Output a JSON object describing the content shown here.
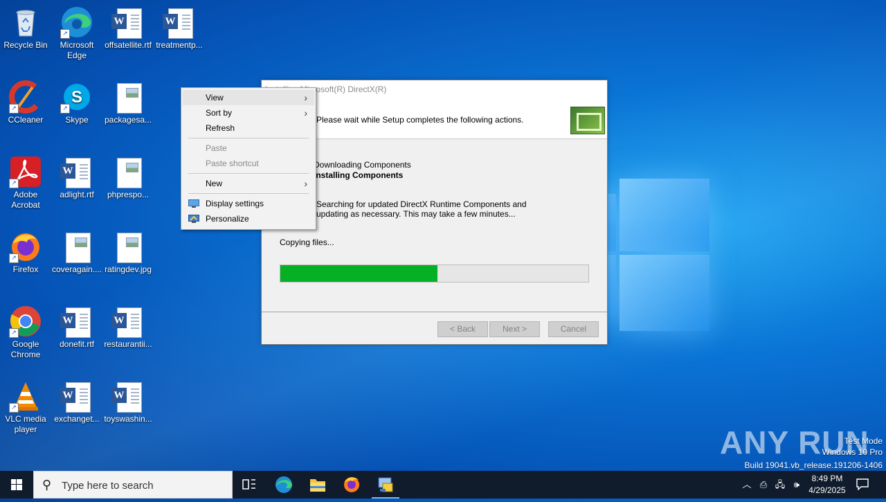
{
  "desktop": {
    "icons": [
      {
        "label": "Recycle Bin",
        "icon": "recycle-bin-icon"
      },
      {
        "label": "Microsoft Edge",
        "icon": "edge-icon"
      },
      {
        "label": "offsatellite.rtf",
        "icon": "word-doc-icon"
      },
      {
        "label": "treatmentp...",
        "icon": "word-doc-icon"
      },
      {
        "label": "CCleaner",
        "icon": "ccleaner-icon"
      },
      {
        "label": "Skype",
        "icon": "skype-icon"
      },
      {
        "label": "packagesa...",
        "icon": "image-file-icon"
      },
      {
        "label": "Adobe Acrobat",
        "icon": "acrobat-icon"
      },
      {
        "label": "adlight.rtf",
        "icon": "word-doc-icon"
      },
      {
        "label": "phprespo...",
        "icon": "image-file-icon"
      },
      {
        "label": "Firefox",
        "icon": "firefox-icon"
      },
      {
        "label": "coveragain....",
        "icon": "image-file-icon"
      },
      {
        "label": "ratingdev.jpg",
        "icon": "image-file-icon"
      },
      {
        "label": "Google Chrome",
        "icon": "chrome-icon"
      },
      {
        "label": "donefit.rtf",
        "icon": "word-doc-icon"
      },
      {
        "label": "restaurantii...",
        "icon": "word-doc-icon"
      },
      {
        "label": "VLC media player",
        "icon": "vlc-icon"
      },
      {
        "label": "exchanget...",
        "icon": "word-doc-icon"
      },
      {
        "label": "toyswashin...",
        "icon": "word-doc-icon"
      }
    ]
  },
  "context_menu": {
    "view": "View",
    "sort_by": "Sort by",
    "refresh": "Refresh",
    "paste": "Paste",
    "paste_shortcut": "Paste shortcut",
    "new": "New",
    "display_settings": "Display settings",
    "personalize": "Personalize"
  },
  "installer": {
    "title": "Installing Microsoft(R) DirectX(R)",
    "description": "Please wait while Setup completes the following actions.",
    "step_done": "Downloading Components",
    "step_current": "Installing Components",
    "detail": "Searching for updated DirectX Runtime Components and updating as necessary. This may take a few minutes...",
    "status": "Copying files...",
    "progress_fraction": 0.51,
    "progress_color": "#06b025",
    "back_label": "< Back",
    "next_label": "Next >",
    "cancel_label": "Cancel"
  },
  "watermark": {
    "brand": "ANY RUN",
    "test_mode": "Test Mode",
    "edition": "Windows 10 Pro",
    "build": "Build 19041.vb_release.191206-1406"
  },
  "taskbar": {
    "search_placeholder": "Type here to search",
    "time": "8:49 PM",
    "date": "4/29/2025",
    "apps": [
      "task-view-icon",
      "edge-icon",
      "file-explorer-icon",
      "firefox-icon",
      "directx-setup-icon"
    ]
  }
}
